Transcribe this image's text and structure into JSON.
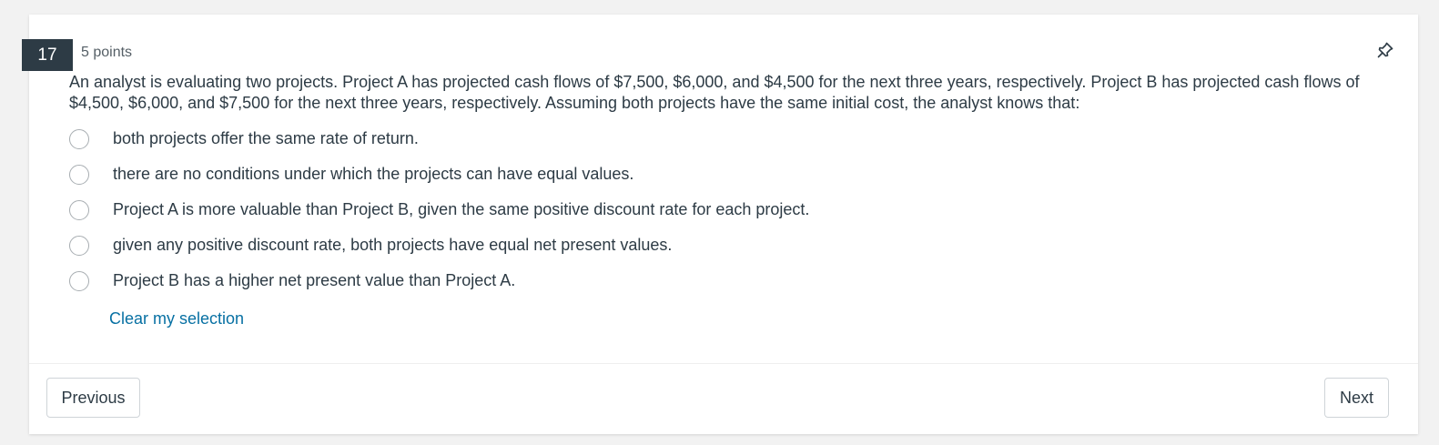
{
  "question": {
    "number": "17",
    "points": "5 points",
    "text": "An analyst is evaluating two projects. Project A has projected cash flows of $7,500, $6,000, and $4,500 for the next three years, respectively. Project B has projected cash flows of $4,500, $6,000, and $7,500 for the next three years, respectively. Assuming both projects have the same initial cost, the analyst knows that:",
    "options": [
      {
        "label": "both projects offer the same rate of return."
      },
      {
        "label": "there are no conditions under which the projects can have equal values."
      },
      {
        "label": "Project A is more valuable than Project B, given the same positive discount rate for each project."
      },
      {
        "label": "given any positive discount rate, both projects have equal net present values."
      },
      {
        "label": "Project B has a higher net present value than Project A."
      }
    ],
    "clear_label": "Clear my selection",
    "pin_icon": "pin-icon"
  },
  "nav": {
    "previous_label": "Previous",
    "next_label": "Next"
  },
  "colors": {
    "badge": "#2d3b45",
    "link": "#0770a3",
    "text": "#2d3b45"
  }
}
